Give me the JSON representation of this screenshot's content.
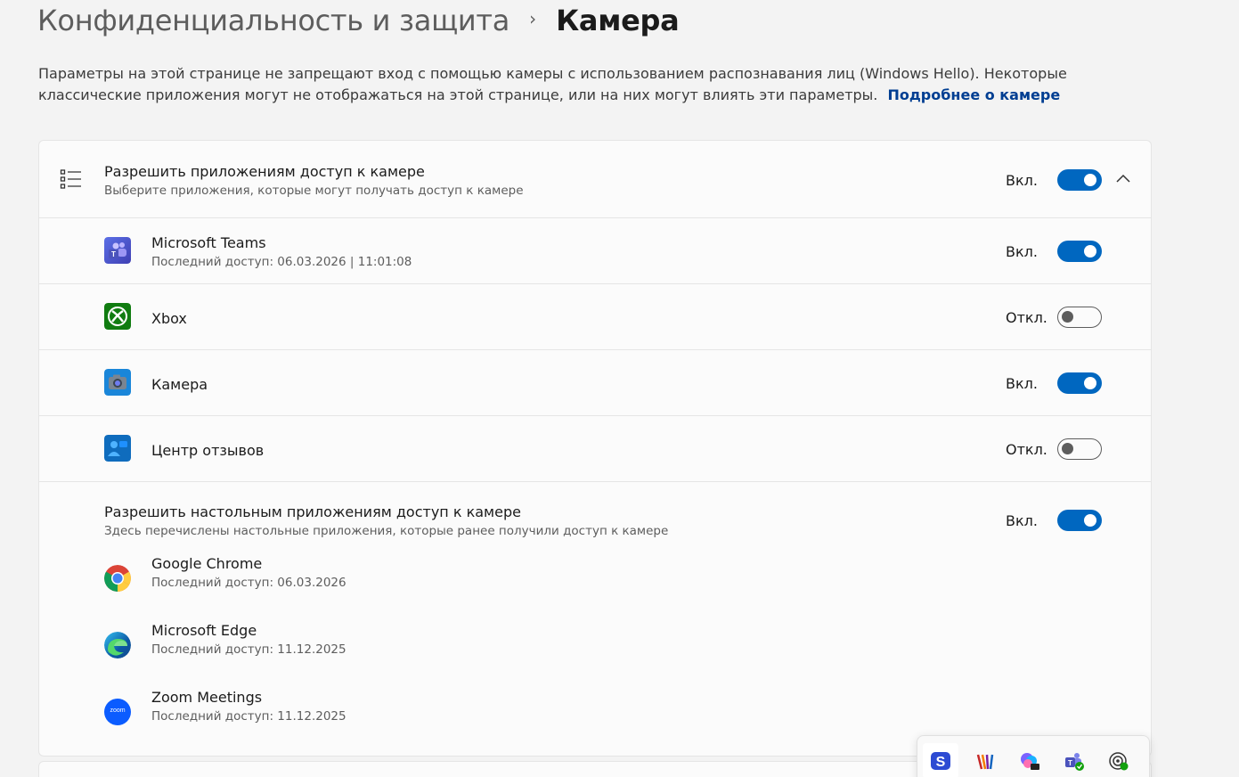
{
  "breadcrumb": {
    "parent": "Конфиденциальность и защита",
    "separator": "›",
    "current": "Камера"
  },
  "description": {
    "text": "Параметры на этой странице не запрещают вход с помощью камеры с использованием распознавания лиц (Windows Hello). Некоторые классические приложения могут не отображаться на этой странице, или на них могут влиять эти параметры.",
    "link": "Подробнее о камере"
  },
  "apps_access": {
    "title": "Разрешить приложениям доступ к камере",
    "subtitle": "Выберите приложения, которые могут получать доступ к камере",
    "state_label": "Вкл.",
    "icon": "list-icon",
    "chevron": "chevron-up-icon",
    "apps": [
      {
        "name": "Microsoft Teams",
        "last_access": "Последний доступ: 06.03.2026  |  11:01:08",
        "state_label": "Вкл.",
        "on": true,
        "icon": "teams-icon"
      },
      {
        "name": "Xbox",
        "last_access": "",
        "state_label": "Откл.",
        "on": false,
        "icon": "xbox-icon"
      },
      {
        "name": "Камера",
        "last_access": "",
        "state_label": "Вкл.",
        "on": true,
        "icon": "camera-app-icon"
      },
      {
        "name": "Центр отзывов",
        "last_access": "",
        "state_label": "Откл.",
        "on": false,
        "icon": "feedback-hub-icon"
      }
    ]
  },
  "desktop_access": {
    "title": "Разрешить настольным приложениям доступ к камере",
    "subtitle": "Здесь перечислены настольные приложения, которые ранее получили доступ к камере",
    "state_label": "Вкл.",
    "apps": [
      {
        "name": "Google Chrome",
        "last_access": "Последний доступ: 06.03.2026",
        "icon": "chrome-icon"
      },
      {
        "name": "Microsoft Edge",
        "last_access": "Последний доступ: 11.12.2025",
        "icon": "edge-icon"
      },
      {
        "name": "Zoom Meetings",
        "last_access": "Последний доступ: 11.12.2025",
        "icon": "zoom-icon",
        "icon_text": "zoom"
      }
    ]
  },
  "tray": {
    "icons": [
      "skype-icon",
      "pencil-stripes-icon",
      "copilot-icon",
      "teams-tray-icon",
      "location-icon"
    ]
  },
  "colors": {
    "accent": "#0067c0",
    "link": "#003e92",
    "background": "#f3f3f3",
    "card": "#fbfbfb"
  }
}
